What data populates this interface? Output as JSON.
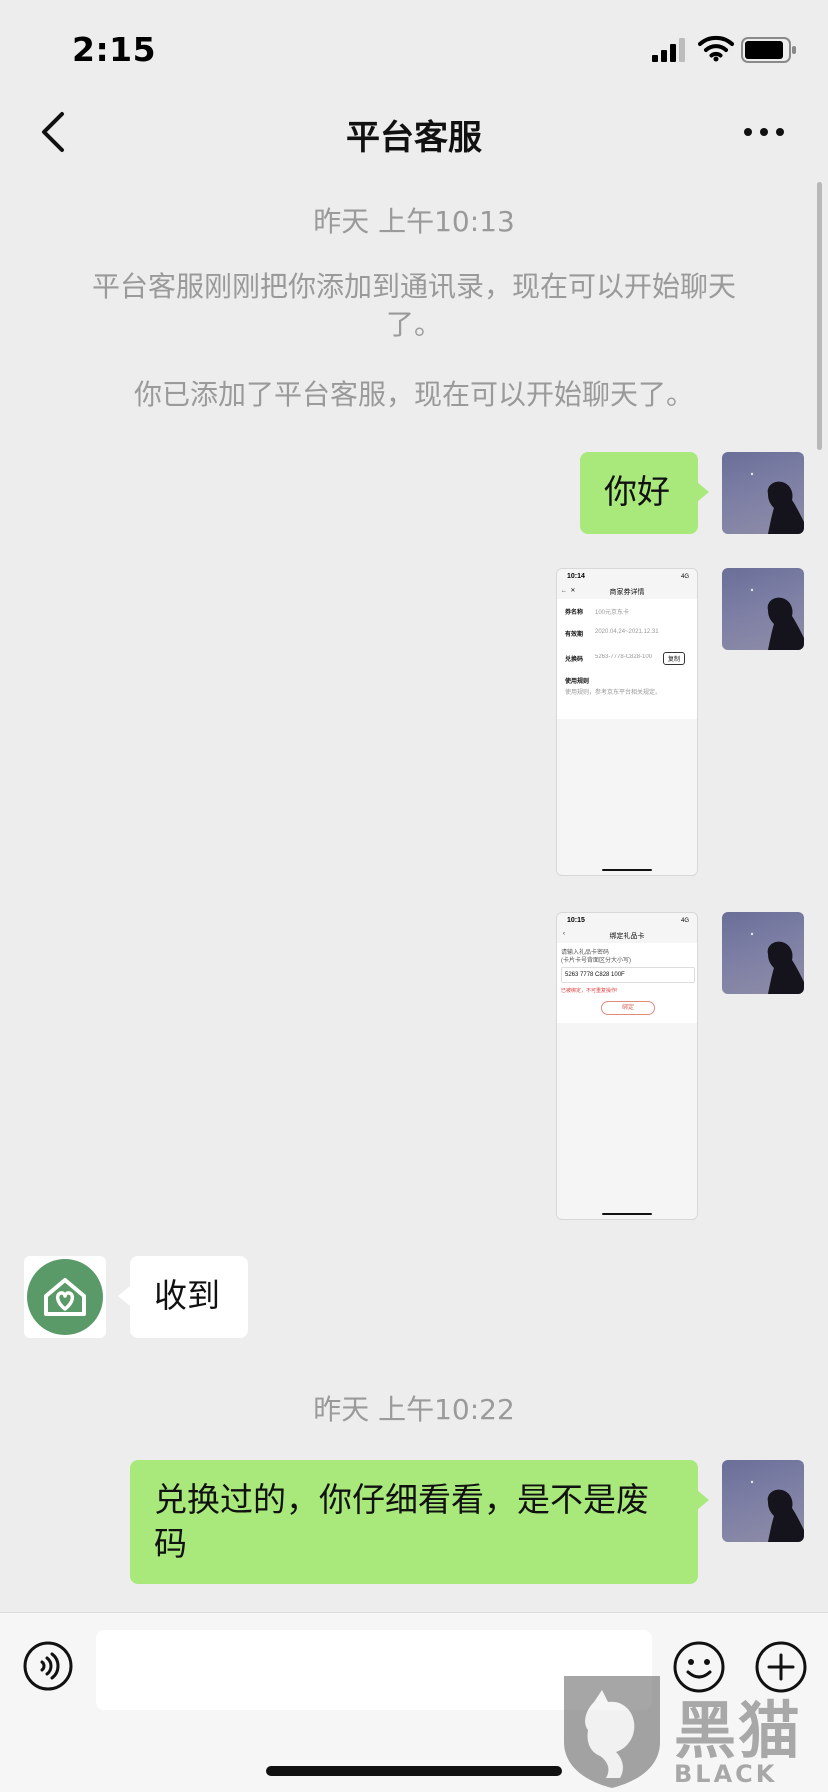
{
  "status_bar": {
    "time": "2:15"
  },
  "nav": {
    "title": "平台客服"
  },
  "chat": {
    "time_1": "昨天 上午10:13",
    "system_1": "平台客服刚刚把你添加到通讯录，现在可以开始聊天了。",
    "system_2": "你已添加了平台客服，现在可以开始聊天了。",
    "msg_hello": "你好",
    "shot_1": {
      "status": "10:14",
      "signal": "4G",
      "title": "商家券详情",
      "row1_label": "券名称",
      "row1_value": "100元京东卡",
      "row2_label": "有效期",
      "row2_value": "2020.04.24~2021.12.31",
      "row3_label": "兑换码",
      "row3_value": "5263-7778-C828-100",
      "copy_label": "复制",
      "rules_label": "使用规则",
      "rules_value": "使用规则，参考京东平台相关规定。"
    },
    "shot_2": {
      "status": "10:15",
      "signal": "4G",
      "title": "绑定礼品卡",
      "hint1": "请输入礼品卡密码",
      "hint2": "(卡片卡号背面区分大小写)",
      "input_value": "5263 7778 C828 100F",
      "error": "已被绑定，不可重复操作!",
      "button": "绑定"
    },
    "msg_received": "收到",
    "time_2": "昨天 上午10:22",
    "msg_last": "兑换过的，你仔细看看，是不是废码"
  },
  "watermark": {
    "brand_cn": "黑猫",
    "brand_en": "BLACK CAT"
  },
  "colors": {
    "background": "#ededed",
    "bubble_self": "#a9e97c",
    "bubble_other": "#ffffff",
    "system_text": "#9a9a9a",
    "service_avatar": "#5a9a68"
  }
}
